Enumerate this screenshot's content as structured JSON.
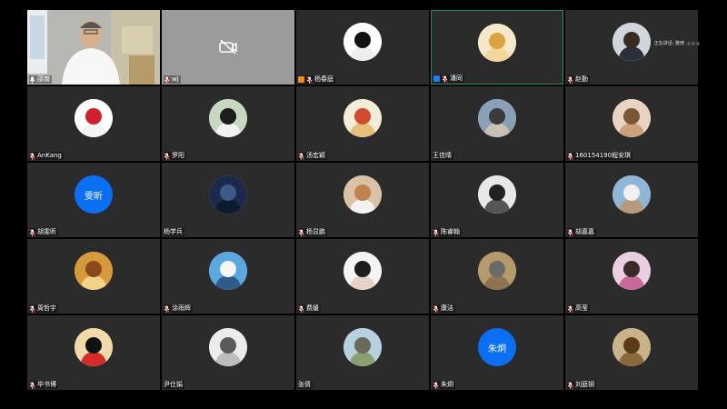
{
  "speaker_indicator": "正在讲话: 雅琦",
  "participants": [
    {
      "name": "邵南",
      "kind": "video",
      "mic": "on",
      "badge": ""
    },
    {
      "name": "wj",
      "kind": "videooff",
      "mic": "off",
      "badge": ""
    },
    {
      "name": "杨春庭",
      "kind": "avatar",
      "mic": "off",
      "badge": "host",
      "av": [
        "#ffffff",
        "#111111",
        "#eeeeee"
      ]
    },
    {
      "name": "潘同",
      "kind": "avatar",
      "mic": "off",
      "badge": "cohost",
      "active": true,
      "av": [
        "#f6e9c9",
        "#d9a441",
        "#f2d79a"
      ]
    },
    {
      "name": "赵勤",
      "kind": "avatar",
      "mic": "off",
      "badge": "",
      "av": [
        "#cfd6dc",
        "#3a2b22",
        "#2a2f3a"
      ]
    },
    {
      "name": "AnKang",
      "kind": "avatar",
      "mic": "off",
      "badge": "",
      "av": [
        "#ffffff",
        "#d21f2b",
        "#f4f4f4"
      ]
    },
    {
      "name": "罗阳",
      "kind": "avatar",
      "mic": "off",
      "badge": "",
      "av": [
        "#c7d7c0",
        "#1d1d1d",
        "#f2f2f2"
      ]
    },
    {
      "name": "汤宏颖",
      "kind": "avatar",
      "mic": "off",
      "badge": "",
      "av": [
        "#f3ecd6",
        "#d24a2e",
        "#e6c07b"
      ]
    },
    {
      "name": "王佳晴",
      "kind": "avatar",
      "mic": "none",
      "badge": "",
      "av": [
        "#8aa0b6",
        "#3b3b3b",
        "#c9c2b4"
      ]
    },
    {
      "name": "160154190程安琪",
      "kind": "avatar",
      "mic": "off",
      "badge": "",
      "av": [
        "#e8d4c0",
        "#7a5636",
        "#c9a27c"
      ]
    },
    {
      "name": "胡雯昕",
      "kind": "text",
      "text": "雯昕",
      "mic": "off",
      "badge": ""
    },
    {
      "name": "杨学兵",
      "kind": "avatar",
      "mic": "none",
      "badge": "",
      "av": [
        "#1b2a4a",
        "#3c5a8a",
        "#0e1a30"
      ]
    },
    {
      "name": "杨显鹏",
      "kind": "avatar",
      "mic": "off",
      "badge": "",
      "av": [
        "#d9c2a6",
        "#c0824e",
        "#f2f2f2"
      ]
    },
    {
      "name": "陈睿翰",
      "kind": "avatar",
      "mic": "off",
      "badge": "",
      "av": [
        "#e8e8e8",
        "#222222",
        "#555555"
      ]
    },
    {
      "name": "胡嘉嘉",
      "kind": "avatar",
      "mic": "off",
      "badge": "",
      "av": [
        "#8fb6d6",
        "#f0f0f0",
        "#b89a7a"
      ]
    },
    {
      "name": "周哲宇",
      "kind": "avatar",
      "mic": "off",
      "badge": "",
      "av": [
        "#d79a3a",
        "#8a4a1e",
        "#f3d28a"
      ]
    },
    {
      "name": "涂雨辉",
      "kind": "avatar",
      "mic": "off",
      "badge": "",
      "av": [
        "#5aa8e0",
        "#f5f5f5",
        "#2c5d8a"
      ]
    },
    {
      "name": "费媛",
      "kind": "avatar",
      "mic": "off",
      "badge": "",
      "av": [
        "#f4f4f4",
        "#1c1c1c",
        "#e6d3c4"
      ]
    },
    {
      "name": "康洁",
      "kind": "avatar",
      "mic": "off",
      "badge": "",
      "av": [
        "#b79a6a",
        "#6a6a6a",
        "#8c7450"
      ]
    },
    {
      "name": "高莹",
      "kind": "avatar",
      "mic": "off",
      "badge": "",
      "av": [
        "#e9cfe0",
        "#3a2a2a",
        "#c76a9a"
      ]
    },
    {
      "name": "毕书博",
      "kind": "avatar",
      "mic": "off",
      "badge": "",
      "av": [
        "#f2d9a8",
        "#111111",
        "#d62a2a"
      ]
    },
    {
      "name": "尹仕娟",
      "kind": "avatar",
      "mic": "none",
      "badge": "",
      "av": [
        "#ececec",
        "#5a5a5a",
        "#bdbdbd"
      ]
    },
    {
      "name": "张倩",
      "kind": "avatar",
      "mic": "none",
      "badge": "",
      "av": [
        "#b7d0e0",
        "#6a6a5a",
        "#8aa070"
      ]
    },
    {
      "name": "朱炯",
      "kind": "text",
      "text": "朱炯",
      "mic": "off",
      "badge": ""
    },
    {
      "name": "刘庭钢",
      "kind": "avatar",
      "mic": "off",
      "badge": "",
      "av": [
        "#c9b48a",
        "#5a3a1a",
        "#8a6a3a"
      ]
    }
  ]
}
